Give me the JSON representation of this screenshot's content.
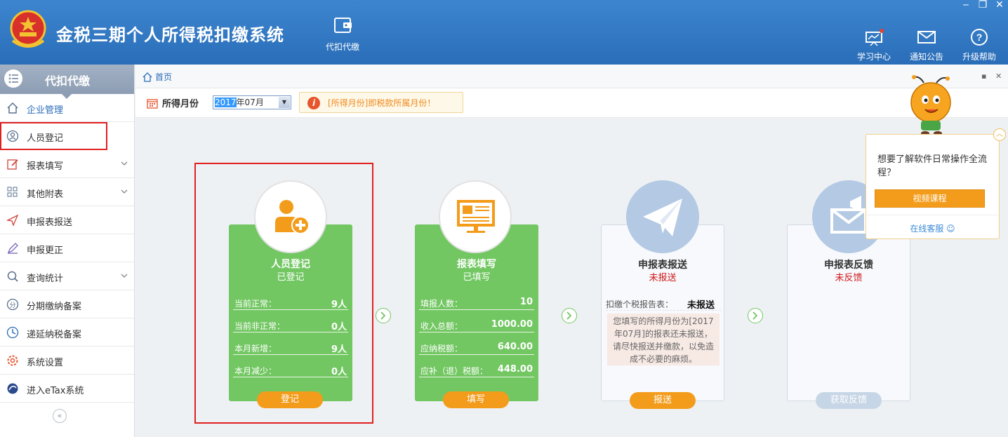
{
  "header": {
    "app_title": "金税三期个人所得税扣缴系统",
    "module_label": "代扣代缴",
    "learning_center": "学习中心",
    "notice": "通知公告",
    "upgrade_help": "升级帮助",
    "window_controls": [
      "‒",
      "❐",
      "✕"
    ]
  },
  "sidebar": {
    "title": "代扣代缴",
    "items": [
      {
        "label": "企业管理",
        "icon": "home-icon",
        "expandable": false
      },
      {
        "label": "人员登记",
        "icon": "person-icon",
        "expandable": false,
        "selected": true
      },
      {
        "label": "报表填写",
        "icon": "edit-icon",
        "expandable": true
      },
      {
        "label": "其他附表",
        "icon": "grid-icon",
        "expandable": true
      },
      {
        "label": "申报表报送",
        "icon": "send-icon",
        "expandable": false
      },
      {
        "label": "申报更正",
        "icon": "pen-icon",
        "expandable": false
      },
      {
        "label": "查询统计",
        "icon": "search-icon",
        "expandable": true
      },
      {
        "label": "分期缴纳备案",
        "icon": "installment-icon",
        "expandable": false
      },
      {
        "label": "递延纳税备案",
        "icon": "deferral-icon",
        "expandable": false
      },
      {
        "label": "系统设置",
        "icon": "gear-icon",
        "expandable": false
      },
      {
        "label": "进入eTax系统",
        "icon": "etax-icon",
        "expandable": false
      }
    ],
    "collapse_label": "«"
  },
  "tabs": {
    "home": "首页",
    "controls": [
      "▪",
      "✕"
    ]
  },
  "toolbar": {
    "month_label": "所得月份",
    "month_year": "2017",
    "month_rest": "年07月",
    "tip": "[所得月份]即税款所属月份！"
  },
  "cards": {
    "register": {
      "title": "人员登记",
      "status": "已登记",
      "rows": [
        {
          "k": "当前正常：",
          "v": "9人"
        },
        {
          "k": "当前非正常：",
          "v": "0人"
        },
        {
          "k": "本月新增：",
          "v": "9人"
        },
        {
          "k": "本月减少：",
          "v": "0人"
        }
      ],
      "button": "登记"
    },
    "fill": {
      "title": "报表填写",
      "status": "已填写",
      "rows": [
        {
          "k": "填报人数：",
          "v": "10"
        },
        {
          "k": "收入总额：",
          "v": "1000.00"
        },
        {
          "k": "应纳税额：",
          "v": "640.00"
        },
        {
          "k": "应补（退）税额：",
          "v": "448.00"
        }
      ],
      "button": "填写"
    },
    "send": {
      "title": "申报表报送",
      "status": "未报送",
      "row_k": "扣缴个税报告表：",
      "row_v": "未报送",
      "note": "您填写的所得月份为[2017年07月]的报表还未报送，请尽快报送并缴款，以免造成不必要的麻烦。",
      "button": "报送"
    },
    "feedback": {
      "title": "申报表反馈",
      "status": "未反馈",
      "button": "获取反馈"
    }
  },
  "help_popup": {
    "question": "想要了解软件日常操作全流程？",
    "video_button": "视频课程",
    "online_service": "在线客服"
  },
  "colors": {
    "header_blue": "#2a6db8",
    "card_green": "#72c762",
    "button_orange": "#f39c1b",
    "alert_red": "#d0191b"
  }
}
